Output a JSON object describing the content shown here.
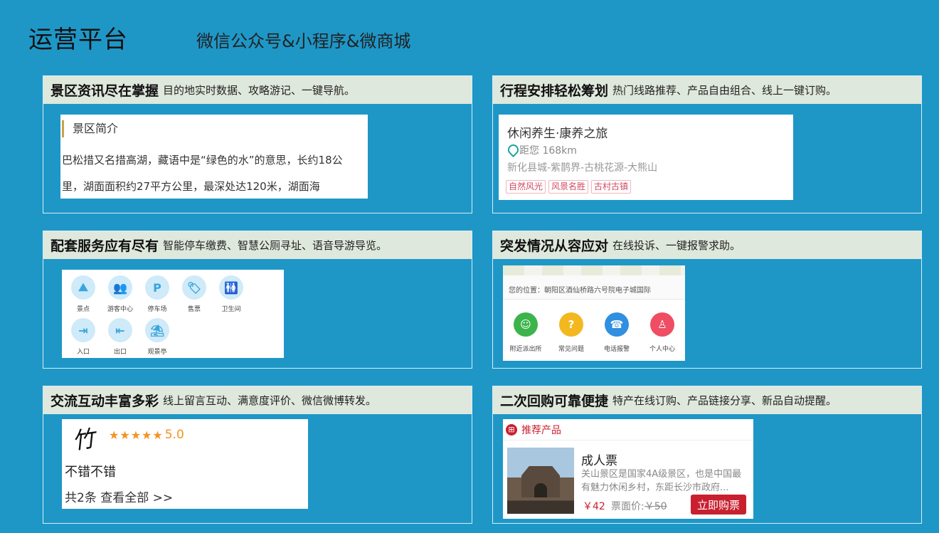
{
  "page": {
    "title": "运营平台",
    "subtitle": "微信公众号&小程序&微商城"
  },
  "panels": [
    {
      "title": "景区资讯尽在掌握",
      "desc": "目的地实时数据、攻略游记、一键导航。"
    },
    {
      "title": "行程安排轻松筹划",
      "desc": "热门线路推荐、产品自由组合、线上一键订购。"
    },
    {
      "title": "配套服务应有尽有",
      "desc": "智能停车缴费、智慧公厕寻址、语音导游导览。"
    },
    {
      "title": "突发情况从容应对",
      "desc": "在线投诉、一键报警求助。"
    },
    {
      "title": "交流互动丰富多彩",
      "desc": "线上留言互动、满意度评价、微信微博转发。"
    },
    {
      "title": "二次回购可靠便捷",
      "desc": "特产在线订购、产品链接分享、新品自动提醒。"
    }
  ],
  "intro": {
    "heading": "景区简介",
    "text": "巴松措又名措高湖，藏语中是“绿色的水”的意思，长约18公里，湖面面积约27平方公里，最深处达120米，湖面海"
  },
  "trip": {
    "title": "休闲养生·康养之旅",
    "distance": "距您 168km",
    "route": "新化县城-紫鹊界-古桃花源-大熊山",
    "tags": [
      "自然风光",
      "风景名胜",
      "古村古镇"
    ]
  },
  "services": {
    "items": [
      {
        "label": "景点",
        "icon": "landscape-icon",
        "glyph": "⛰"
      },
      {
        "label": "游客中心",
        "icon": "users-icon",
        "glyph": "👥"
      },
      {
        "label": "停车场",
        "icon": "parking-icon",
        "glyph": "P"
      },
      {
        "label": "售票",
        "icon": "ticket-icon",
        "glyph": "🏷"
      },
      {
        "label": "卫生间",
        "icon": "restroom-icon",
        "glyph": "🚻"
      },
      {
        "label": "入口",
        "icon": "entrance-icon",
        "glyph": "⇥"
      },
      {
        "label": "出口",
        "icon": "exit-icon",
        "glyph": "⇤"
      },
      {
        "label": "观景亭",
        "icon": "pavilion-icon",
        "glyph": "⛱"
      }
    ]
  },
  "emergency": {
    "location": "您的位置：朝阳区酒仙桥路六号院电子城国际",
    "items": [
      {
        "label": "附近派出所",
        "icon": "police-icon",
        "color": "#3cb44b",
        "glyph": "☺"
      },
      {
        "label": "常见问题",
        "icon": "question-icon",
        "color": "#f3b81f",
        "glyph": "?"
      },
      {
        "label": "电话报警",
        "icon": "phone-icon",
        "color": "#2f8fe0",
        "glyph": "☎"
      },
      {
        "label": "个人中心",
        "icon": "person-icon",
        "color": "#ee4d64",
        "glyph": "♙"
      }
    ]
  },
  "review": {
    "signature": "竹",
    "stars": "★★★★★",
    "score": "5.0",
    "text": "不错不错",
    "more": "共2条 查看全部 >>"
  },
  "product": {
    "section": "推荐产品",
    "name": "成人票",
    "desc": "关山景区是国家4A级景区，也是中国最有魅力休闲乡村，东距长沙市政府...",
    "price": "￥42",
    "orig_label": "票面价:",
    "orig_price": "￥50",
    "buy": "立即购票"
  },
  "colors": {
    "background": "#1e97c7",
    "panel_header": "#dfe8dc",
    "accent_red": "#c9202f",
    "star": "#f39321"
  }
}
